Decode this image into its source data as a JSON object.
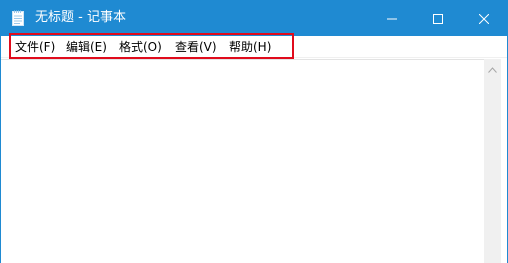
{
  "window": {
    "title": "无标题 - 记事本",
    "app_icon": "notepad-icon",
    "controls": [
      "minimize-icon",
      "maximize-icon",
      "close-icon"
    ]
  },
  "menubar": {
    "items": [
      {
        "label": "文件(F)"
      },
      {
        "label": "编辑(E)"
      },
      {
        "label": "格式(O)"
      },
      {
        "label": "查看(V)"
      },
      {
        "label": "帮助(H)"
      }
    ]
  },
  "editor": {
    "content": ""
  },
  "colors": {
    "titlebar": "#1f8ad2",
    "highlight_box": "#e00b1c",
    "scrollbar": "#f0f0f0"
  }
}
